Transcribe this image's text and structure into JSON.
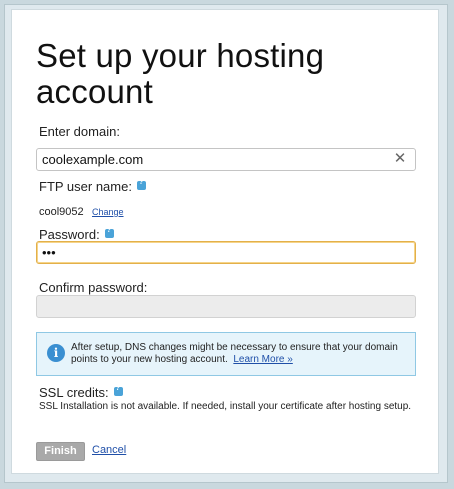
{
  "page": {
    "title": "Set up your hosting account"
  },
  "domain": {
    "label": "Enter domain:",
    "value": "coolexample.com",
    "clear_symbol": "✕"
  },
  "ftp": {
    "label": "FTP user name:",
    "value": "cool9052",
    "change_link": "Change"
  },
  "password": {
    "label": "Password:",
    "value": "•••"
  },
  "confirm_password": {
    "label": "Confirm password:",
    "value": ""
  },
  "info": {
    "icon_glyph": "i",
    "text": "After setup, DNS changes might be necessary to ensure that your domain points to your new hosting account.",
    "link": "Learn More »"
  },
  "ssl": {
    "label": "SSL credits:",
    "note": "SSL Installation is not available. If needed, install your certificate after hosting setup."
  },
  "actions": {
    "finish_label": "Finish",
    "cancel_label": "Cancel"
  },
  "colors": {
    "info_bg": "#e6f4fb",
    "info_border": "#8fc8e4",
    "link": "#1f4fa8",
    "focus_border": "#e3b04a",
    "disabled_button": "#a9a9a9"
  }
}
